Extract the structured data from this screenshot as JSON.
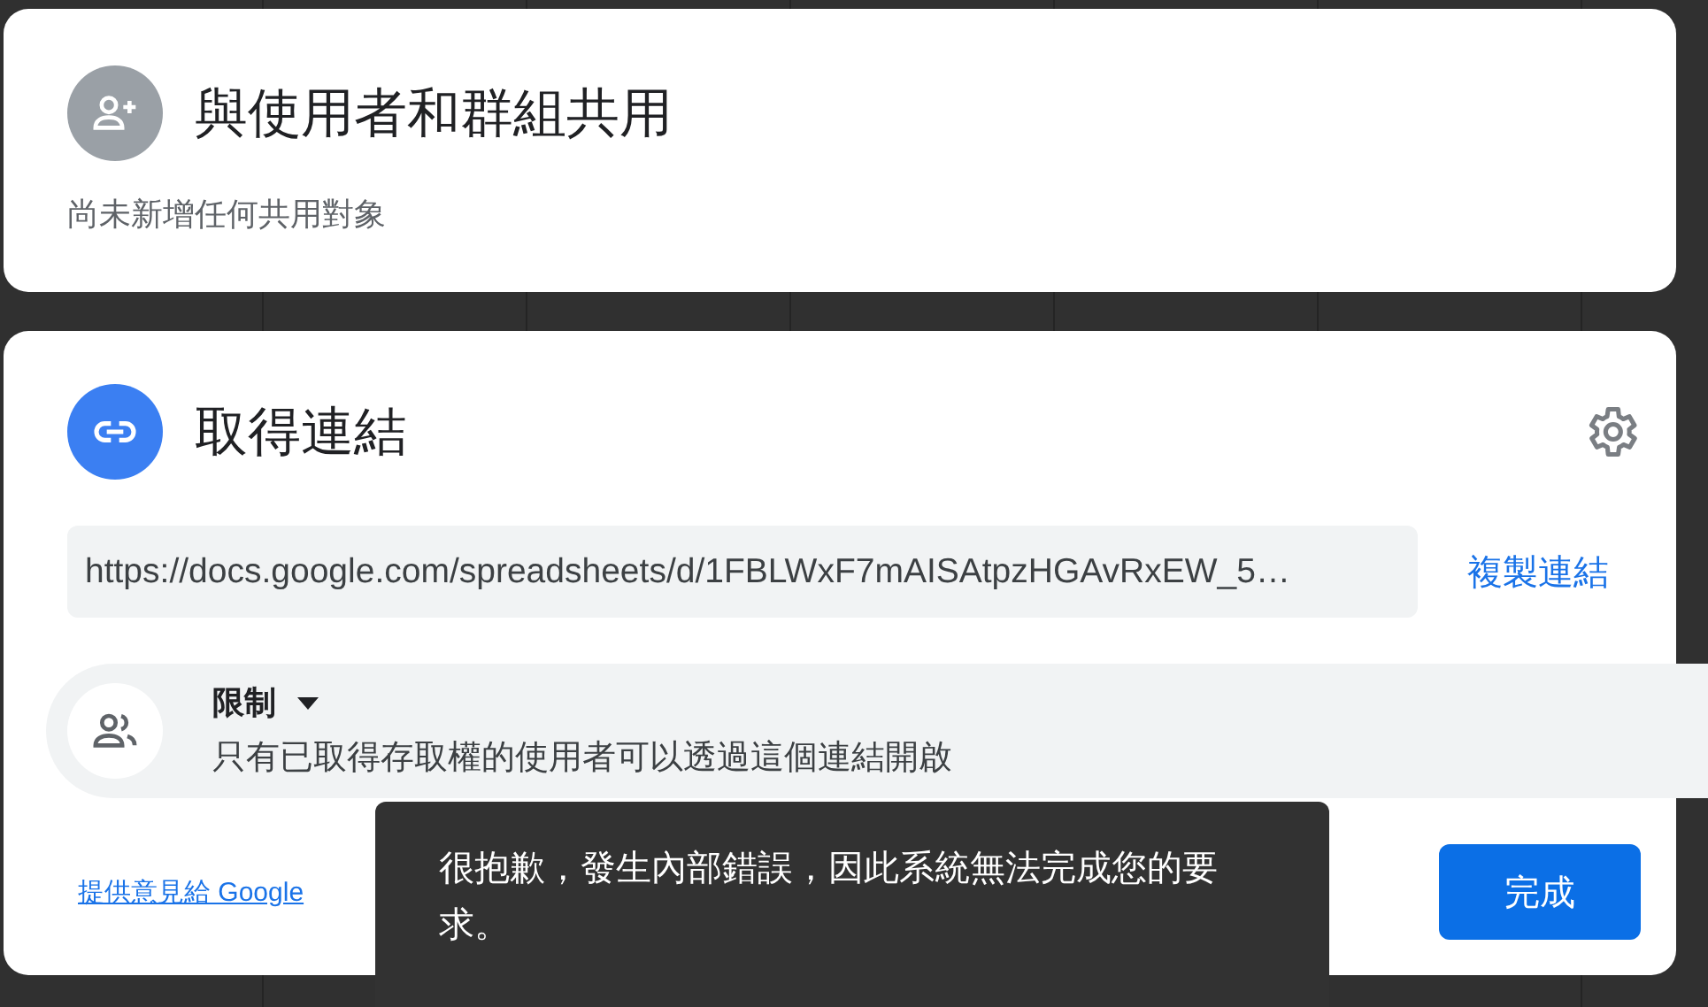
{
  "share_card": {
    "title": "與使用者和群組共用",
    "status": "尚未新增任何共用對象"
  },
  "link_card": {
    "title": "取得連結",
    "url": "https://docs.google.com/spreadsheets/d/1FBLWxF7mAISAtpzHGAvRxEW_5…",
    "copy_label": "複製連結",
    "access": {
      "label": "限制",
      "description": "只有已取得存取權的使用者可以透過這個連結開啟"
    },
    "feedback_link": "提供意見給 Google",
    "done_button": "完成"
  },
  "toast": {
    "message": "很抱歉，發生內部錯誤，因此系統無法完成您的要求。"
  }
}
